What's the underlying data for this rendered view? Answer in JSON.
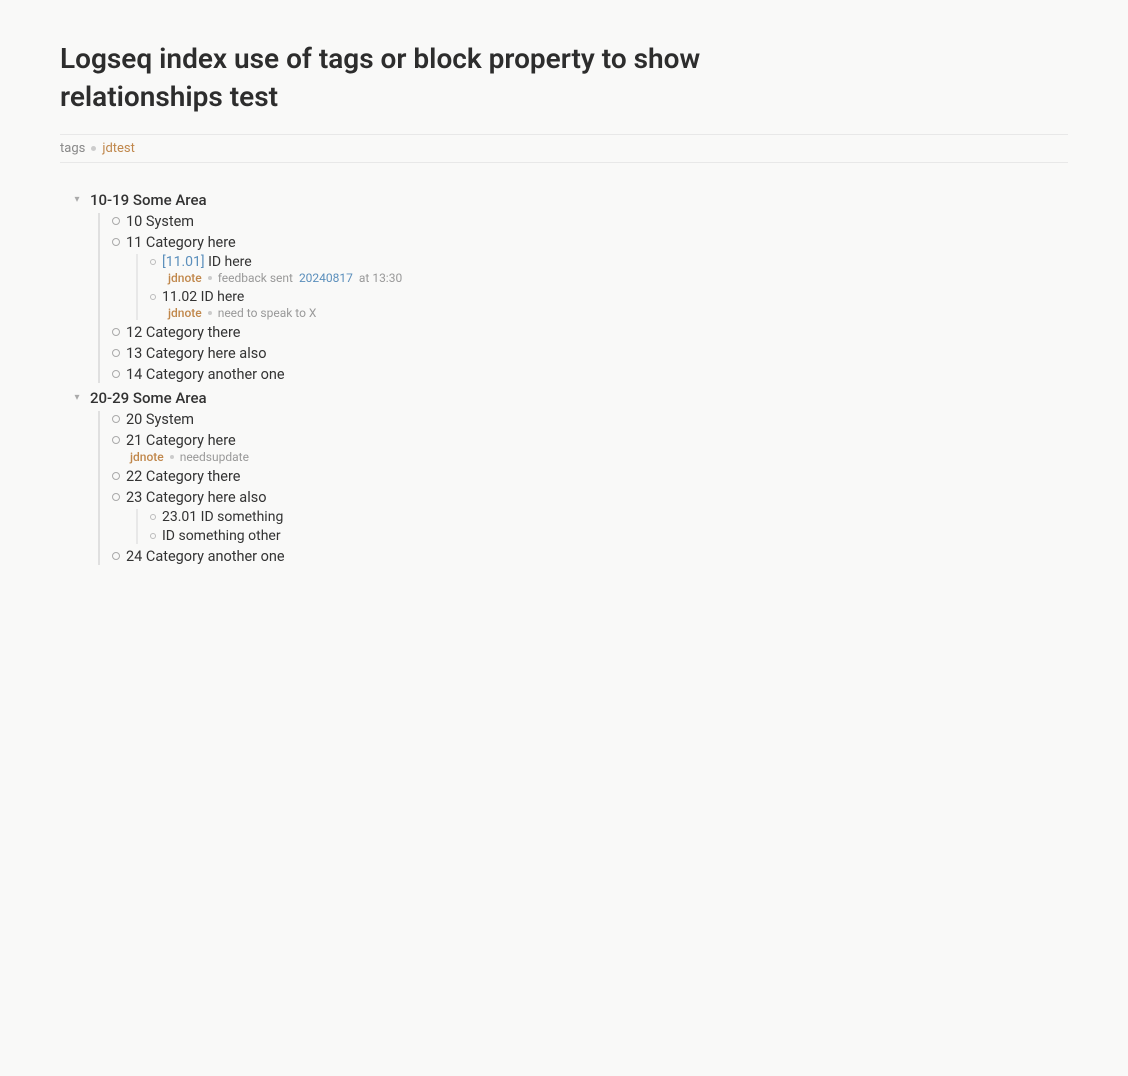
{
  "page": {
    "title": "Logseq index use of tags or block property to show relationships test",
    "breadcrumb": {
      "prefix": "tags",
      "dot": "•",
      "link": "jdtest"
    }
  },
  "outline": {
    "areas": [
      {
        "id": "area-10-19",
        "label": "10-19 Some Area",
        "expanded": true,
        "children": [
          {
            "id": "cat-10",
            "label": "10 System",
            "children": []
          },
          {
            "id": "cat-11",
            "label": "11 Category here",
            "children": [
              {
                "id": "id-11-01",
                "label_prefix": "[11.01]",
                "label_main": " ID here",
                "has_bracket": true,
                "meta": {
                  "tag": "jdnote",
                  "dot": "•",
                  "text_prefix": "feedback sent ",
                  "date": "20240817",
                  "text_suffix": " at 13:30"
                }
              },
              {
                "id": "id-11-02",
                "label": "11.02 ID here",
                "has_bracket": false,
                "meta": {
                  "tag": "jdnote",
                  "dot": "•",
                  "text": "need to speak to X"
                }
              }
            ]
          },
          {
            "id": "cat-12",
            "label": "12 Category there",
            "children": []
          },
          {
            "id": "cat-13",
            "label": "13 Category here also",
            "children": []
          },
          {
            "id": "cat-14",
            "label": "14 Category another one",
            "children": []
          }
        ]
      },
      {
        "id": "area-20-29",
        "label": "20-29 Some Area",
        "expanded": true,
        "children": [
          {
            "id": "cat-20",
            "label": "20 System",
            "children": []
          },
          {
            "id": "cat-21",
            "label": "21 Category here",
            "inline_meta": {
              "tag": "jdnote",
              "dot": "•",
              "text": "needsupdate"
            },
            "children": []
          },
          {
            "id": "cat-22",
            "label": "22 Category there",
            "children": []
          },
          {
            "id": "cat-23",
            "label": "23 Category here also",
            "children": [
              {
                "id": "id-23-01",
                "label": "23.01 ID something",
                "has_bracket": false,
                "meta": null
              },
              {
                "id": "id-something-other",
                "label": "ID something other",
                "has_bracket": false,
                "meta": null
              }
            ]
          },
          {
            "id": "cat-24",
            "label": "24 Category another one",
            "children": []
          }
        ]
      }
    ]
  },
  "icons": {
    "arrow_down": "▾",
    "arrow_right": "▸"
  }
}
